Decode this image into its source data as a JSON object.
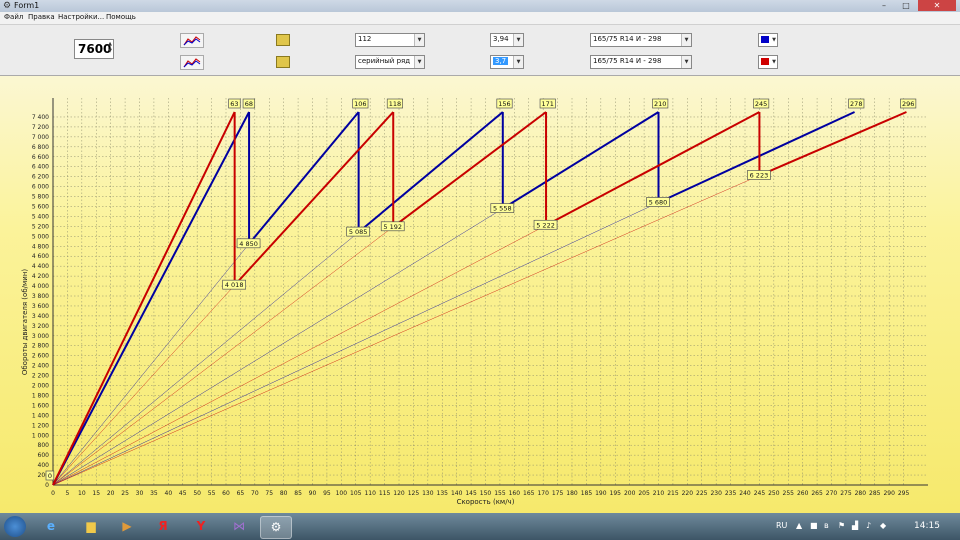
{
  "window": {
    "title": "Form1",
    "minimize": "–",
    "maximize": "□",
    "close": "✕"
  },
  "menu": [
    "Файл",
    "Правка",
    "Настройки...",
    "Помощь"
  ],
  "toolbar": {
    "rpm_value": "7600",
    "row1": {
      "gear_set": "112",
      "final_drive": "3,94",
      "tire": "165/75  R14  И - 298",
      "color": "#0000c8"
    },
    "row2": {
      "gear_set": "серийный ряд",
      "final_drive": "3,7",
      "tire": "165/75  R14  И - 298",
      "color": "#d00000"
    }
  },
  "chart_data": {
    "type": "line",
    "xlabel": "Скорость (км/ч)",
    "ylabel": "Обороты двигателя (об/мин)",
    "xlim": [
      0,
      300
    ],
    "ylim": [
      0,
      7500
    ],
    "x_ticks": [
      0,
      5,
      10,
      15,
      20,
      25,
      30,
      35,
      40,
      45,
      50,
      55,
      60,
      65,
      70,
      75,
      80,
      85,
      90,
      95,
      100,
      105,
      110,
      115,
      120,
      125,
      130,
      135,
      140,
      145,
      150,
      155,
      160,
      165,
      170,
      175,
      180,
      185,
      190,
      195,
      200,
      205,
      210,
      215,
      220,
      225,
      230,
      235,
      240,
      245,
      250,
      255,
      260,
      265,
      270,
      275,
      280,
      285,
      290,
      295
    ],
    "y_ticks": [
      0,
      200,
      400,
      600,
      800,
      1000,
      1200,
      1400,
      1600,
      1800,
      2000,
      2200,
      2400,
      2600,
      2800,
      3000,
      3200,
      3400,
      3600,
      3800,
      4000,
      4200,
      4400,
      4600,
      4800,
      5000,
      5200,
      5400,
      5600,
      5800,
      6000,
      6200,
      6400,
      6600,
      6800,
      7000,
      7200,
      7400
    ],
    "grid": true,
    "series": [
      {
        "color": "#0000a0",
        "gear_lines": [
          {
            "x": [
              0,
              68
            ],
            "y": [
              0,
              7500
            ]
          },
          {
            "x": [
              68,
              106
            ],
            "y": [
              4850,
              7500
            ]
          },
          {
            "x": [
              106,
              156
            ],
            "y": [
              5085,
              7500
            ]
          },
          {
            "x": [
              156,
              210
            ],
            "y": [
              5558,
              7500
            ]
          },
          {
            "x": [
              210,
              278
            ],
            "y": [
              5680,
              7500
            ]
          }
        ],
        "shift_drops": [
          {
            "x": 68,
            "from": 7500,
            "to": 4850
          },
          {
            "x": 106,
            "from": 7500,
            "to": 5085
          },
          {
            "x": 156,
            "from": 7500,
            "to": 5558
          },
          {
            "x": 210,
            "from": 7500,
            "to": 5680
          }
        ],
        "top_labels": [
          {
            "x": 68,
            "text": "68"
          },
          {
            "x": 106,
            "text": "106"
          },
          {
            "x": 156,
            "text": "156"
          },
          {
            "x": 210,
            "text": "210"
          },
          {
            "x": 278,
            "text": "278"
          }
        ],
        "drop_labels": [
          {
            "x": 68,
            "y": 4850,
            "text": "4 850"
          },
          {
            "x": 106,
            "y": 5085,
            "text": "5 085"
          },
          {
            "x": 156,
            "y": 5558,
            "text": "5 558"
          },
          {
            "x": 210,
            "y": 5680,
            "text": "5 680"
          }
        ]
      },
      {
        "color": "#c80000",
        "gear_lines": [
          {
            "x": [
              0,
              63
            ],
            "y": [
              0,
              7500
            ]
          },
          {
            "x": [
              63,
              118
            ],
            "y": [
              4018,
              7500
            ]
          },
          {
            "x": [
              118,
              171
            ],
            "y": [
              5192,
              7500
            ]
          },
          {
            "x": [
              171,
              245
            ],
            "y": [
              5222,
              7500
            ]
          },
          {
            "x": [
              245,
              296
            ],
            "y": [
              6223,
              7500
            ]
          }
        ],
        "shift_drops": [
          {
            "x": 63,
            "from": 7500,
            "to": 4018
          },
          {
            "x": 118,
            "from": 7500,
            "to": 5192
          },
          {
            "x": 171,
            "from": 7500,
            "to": 5222
          },
          {
            "x": 245,
            "from": 7500,
            "to": 6223
          }
        ],
        "top_labels": [
          {
            "x": 63,
            "text": "63"
          },
          {
            "x": 118,
            "text": "118"
          },
          {
            "x": 171,
            "text": "171"
          },
          {
            "x": 245,
            "text": "245"
          },
          {
            "x": 296,
            "text": "296"
          }
        ],
        "drop_labels": [
          {
            "x": 63,
            "y": 4018,
            "text": "4 018"
          },
          {
            "x": 118,
            "y": 5192,
            "text": "5 192"
          },
          {
            "x": 171,
            "y": 5222,
            "text": "5 222"
          },
          {
            "x": 245,
            "y": 6223,
            "text": "6 223"
          }
        ]
      }
    ],
    "origin_label": "0"
  },
  "taskbar": {
    "lang": "RU",
    "time": "14:15"
  }
}
